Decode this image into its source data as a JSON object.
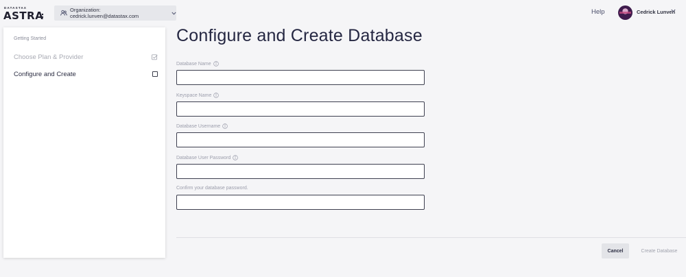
{
  "header": {
    "logo_small": "DATASTAX",
    "logo_big": "ASTRA",
    "org_label": "Organization: cedrick.lunven@datastax.com",
    "help_label": "Help",
    "user_name": "Cedrick Lunven"
  },
  "sidebar": {
    "section_title": "Getting Started",
    "items": [
      {
        "label": "Choose Plan & Provider",
        "state": "completed",
        "icon": "checked-box-icon"
      },
      {
        "label": "Configure and Create",
        "state": "current",
        "icon": "empty-checkbox-icon"
      }
    ]
  },
  "main": {
    "title": "Configure and Create Database",
    "fields": [
      {
        "label": "Database Name",
        "value": "",
        "info": true
      },
      {
        "label": "Keyspace Name",
        "value": "",
        "info": true
      },
      {
        "label": "Database Username",
        "value": "",
        "info": true
      },
      {
        "label": "Database User Password",
        "value": "",
        "info": true
      },
      {
        "label": "Confirm your database password.",
        "value": "",
        "info": false
      }
    ]
  },
  "actions": {
    "cancel_label": "Cancel",
    "create_label": "Create Database"
  },
  "colors": {
    "background": "#f5f5f7",
    "sidebar_bg": "#ffffff",
    "title": "#252742",
    "muted_text": "#9b9dab",
    "input_border": "#3c3e4e",
    "cancel_bg": "#e3e4e8"
  }
}
